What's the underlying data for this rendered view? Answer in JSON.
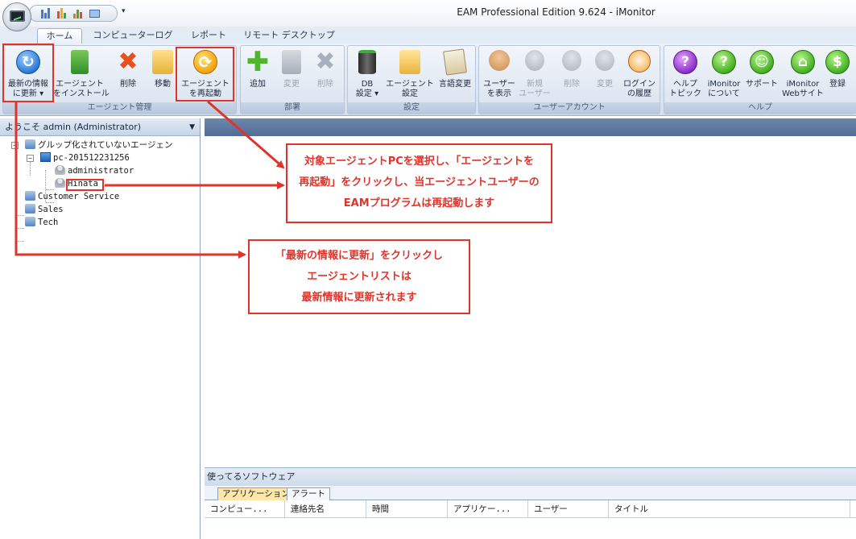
{
  "window": {
    "title": "EAM Professional Edition 9.624 - iMonitor"
  },
  "quick_access": {
    "icons": [
      "bar-chart-icon",
      "bar-chart-color-icon",
      "stats-icon",
      "monitor-small-icon"
    ],
    "more": "▾"
  },
  "tabs": [
    {
      "label": "ホーム",
      "active": true
    },
    {
      "label": "コンピューターログ"
    },
    {
      "label": "レポート"
    },
    {
      "label": "リモート デスクトップ"
    }
  ],
  "ribbon": {
    "groups": [
      {
        "label": "エージェント管理",
        "buttons": [
          {
            "label": "最新の情報\nに更新 ▾",
            "icon": "refresh-icon"
          },
          {
            "label": "エージェント\nをインストール",
            "icon": "install-agent-icon"
          },
          {
            "label": "削除",
            "icon": "delete-icon"
          },
          {
            "label": "移動",
            "icon": "move-icon"
          },
          {
            "label": "エージェント\nを再起動",
            "icon": "restart-agent-icon"
          }
        ]
      },
      {
        "label": "部署",
        "buttons": [
          {
            "label": "追加",
            "icon": "add-icon"
          },
          {
            "label": "変更",
            "icon": "edit-icon",
            "disabled": true
          },
          {
            "label": "削除",
            "icon": "delete-icon",
            "disabled": true
          }
        ]
      },
      {
        "label": "設定",
        "buttons": [
          {
            "label": "DB\n設定 ▾",
            "icon": "database-icon"
          },
          {
            "label": "エージェント\n設定",
            "icon": "agent-settings-icon"
          },
          {
            "label": "言語変更",
            "icon": "language-icon"
          }
        ]
      },
      {
        "label": "ユーザーアカウント",
        "buttons": [
          {
            "label": "ユーザー\nを表示",
            "icon": "users-icon"
          },
          {
            "label": "新規\nユーザー",
            "icon": "new-user-icon",
            "disabled": true
          },
          {
            "label": "削除",
            "icon": "delete-user-icon",
            "disabled": true
          },
          {
            "label": "変更",
            "icon": "edit-user-icon",
            "disabled": true
          },
          {
            "label": "ログイン\nの履歴",
            "icon": "login-history-icon"
          }
        ]
      },
      {
        "label": "ヘルプ",
        "buttons": [
          {
            "label": "ヘルプ\nトピック",
            "icon": "help-icon",
            "glyph": "?"
          },
          {
            "label": "iMonitor\nについて",
            "icon": "about-icon",
            "glyph": "?"
          },
          {
            "label": "サポート",
            "icon": "support-icon",
            "glyph": "☺"
          },
          {
            "label": "iMonitor\nWebサイト",
            "icon": "website-icon",
            "glyph": "⌂"
          },
          {
            "label": "登録",
            "icon": "register-icon",
            "glyph": "$"
          }
        ]
      }
    ]
  },
  "left_panel": {
    "header": "ようこそ admin (Administrator)",
    "tree": {
      "root": "グルップ化されていないエージェン",
      "pc": "pc-201512231256",
      "users": [
        "administrator",
        "Hinata"
      ],
      "groups": [
        "Customer Service",
        "Sales",
        "Tech"
      ]
    }
  },
  "bottom_panel": {
    "title": "使ってるソフトウェア",
    "tabs": [
      "アプリケーション",
      "アラート"
    ],
    "columns": [
      "コンピュー...",
      "連絡先名",
      "時間",
      "アプリケー...",
      "ユーザー",
      "タイトル"
    ]
  },
  "annotations": {
    "callout_restart": [
      "対象エージェントPCを選択し、「エージェントを",
      "再起動」をクリックし、当エージェントユーザーの",
      "EAMプログラムは再起動します"
    ],
    "callout_refresh": [
      "「最新の情報に更新」をクリックし",
      "エージェントリストは",
      "最新情報に更新されます"
    ],
    "color": "#e0342b"
  }
}
